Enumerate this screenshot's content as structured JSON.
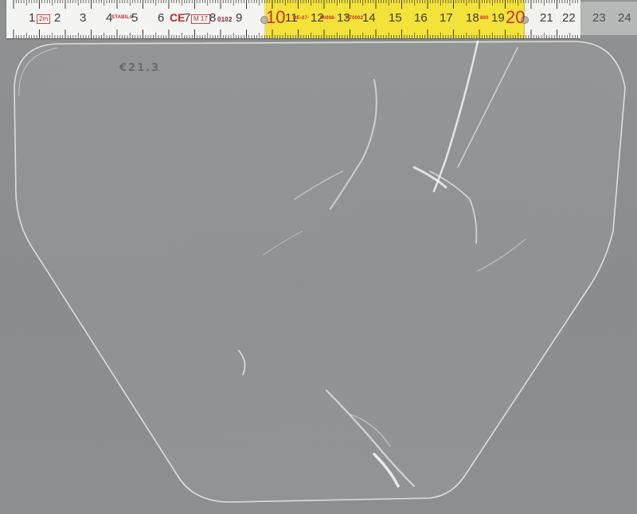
{
  "ruler": {
    "numbers": [
      "1",
      "2",
      "3",
      "4",
      "5",
      "6",
      "7",
      "8",
      "9",
      "10",
      "11",
      "12",
      "13",
      "14",
      "15",
      "16",
      "17",
      "18",
      "19",
      "20",
      "21",
      "22",
      "23",
      "24"
    ],
    "marks": {
      "box_2m": "2m",
      "stabila": "STABILA",
      "ce": "CE",
      "box_m17": "M 17",
      "code_0102": "0102",
      "code_de": "DE-07-",
      "code_mi": "MI008-",
      "code_pt": "PT0002",
      "code_800": "800"
    }
  },
  "lens": {
    "engraving": "€21.3"
  },
  "colors": {
    "background": "#8e9192",
    "ruler_white": "#f4f4f2",
    "ruler_yellow": "#f3e23a",
    "ruler_ink": "#3b3b3b",
    "ruler_red": "#d32d2d",
    "lens_edge": "#e6ecec"
  }
}
